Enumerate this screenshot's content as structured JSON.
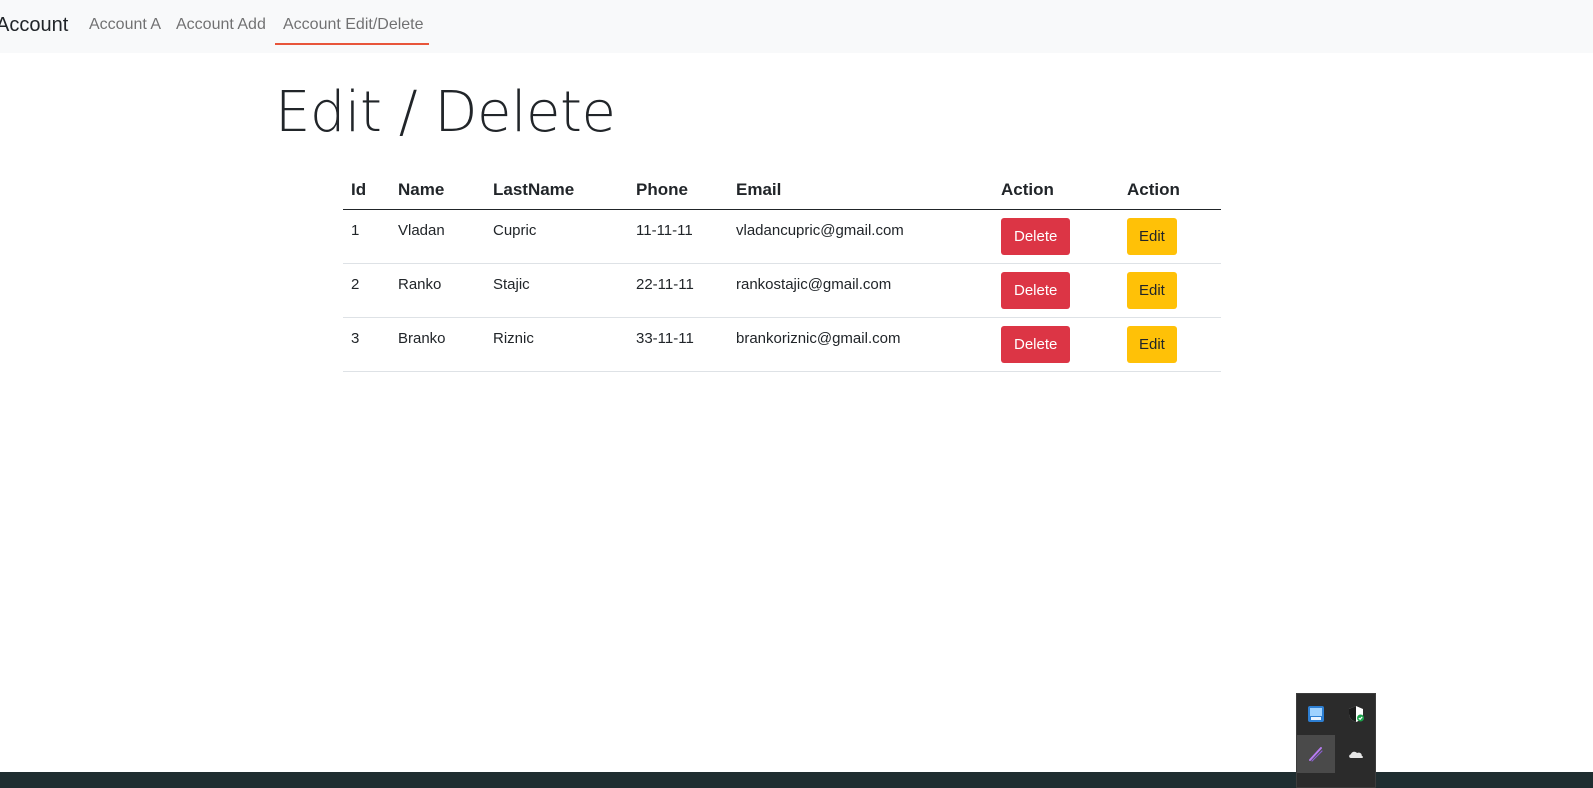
{
  "navbar": {
    "brand": "Account",
    "links": [
      {
        "label": "Account A",
        "active": false
      },
      {
        "label": "Account Add",
        "active": false
      },
      {
        "label": "Account Edit/Delete",
        "active": true
      }
    ],
    "active_color": "#e8553a"
  },
  "main": {
    "title": "Edit / Delete",
    "table": {
      "headers": [
        "Id",
        "Name",
        "LastName",
        "Phone",
        "Email",
        "Action",
        "Action"
      ],
      "rows": [
        {
          "id": "1",
          "name": "Vladan",
          "lastname": "Cupric",
          "phone": "11-11-11",
          "email": "vladancupric@gmail.com",
          "delete_label": "Delete",
          "edit_label": "Edit"
        },
        {
          "id": "2",
          "name": "Ranko",
          "lastname": "Stajic",
          "phone": "22-11-11",
          "email": "rankostajic@gmail.com",
          "delete_label": "Delete",
          "edit_label": "Edit"
        },
        {
          "id": "3",
          "name": "Branko",
          "lastname": "Riznic",
          "phone": "33-11-11",
          "email": "brankoriznic@gmail.com",
          "delete_label": "Delete",
          "edit_label": "Edit"
        }
      ]
    },
    "colors": {
      "delete": "#dc3545",
      "edit": "#ffc107"
    }
  },
  "system_tray": {
    "icons": [
      "network-app-icon",
      "security-shield-icon",
      "pen-icon",
      "cloud-icon"
    ]
  }
}
